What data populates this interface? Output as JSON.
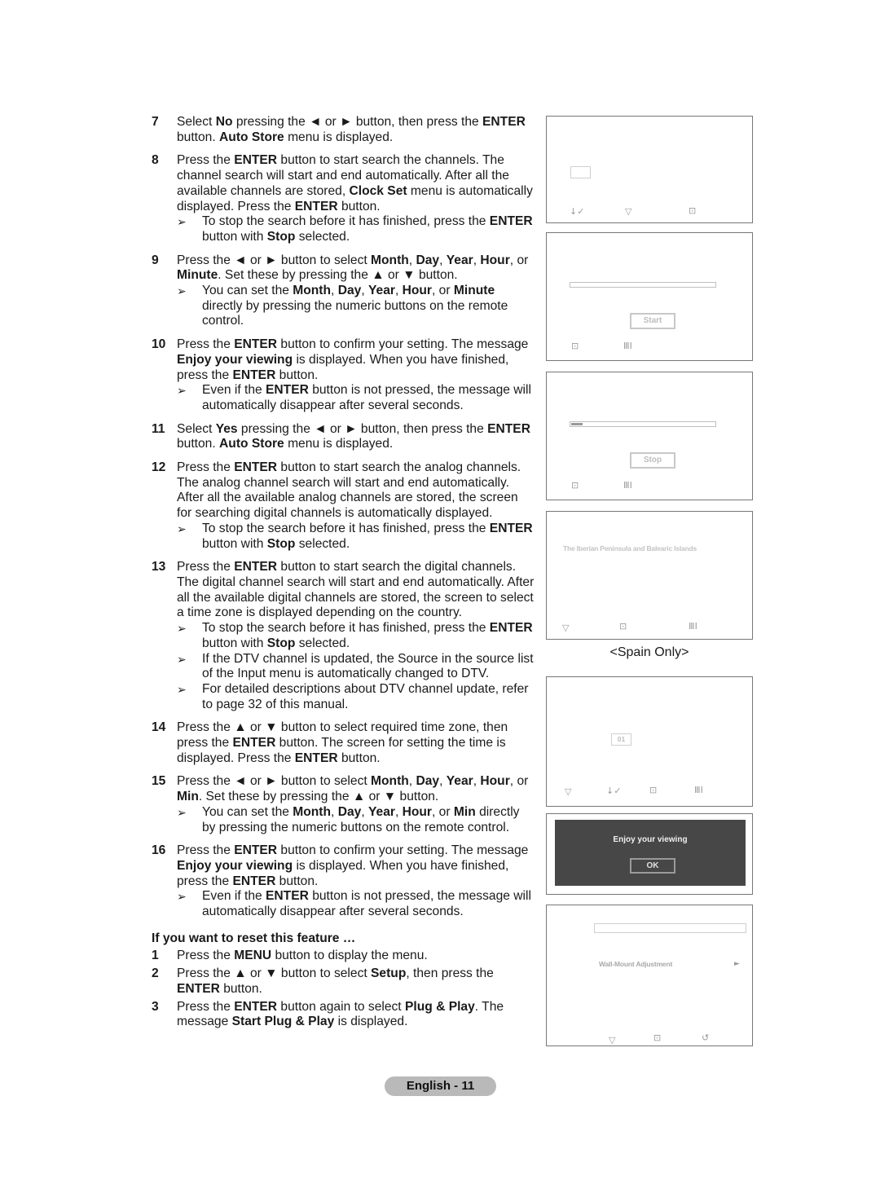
{
  "steps": [
    {
      "num": "7",
      "text": [
        {
          "t": "Select "
        },
        {
          "b": "No"
        },
        {
          "t": " pressing the ◄ or ► button, then press the "
        },
        {
          "b": "ENTER"
        },
        {
          "t": " button. "
        },
        {
          "b": "Auto Store"
        },
        {
          "t": " menu is displayed."
        }
      ],
      "notes": []
    },
    {
      "num": "8",
      "text": [
        {
          "t": "Press the "
        },
        {
          "b": "ENTER"
        },
        {
          "t": " button to start search the channels. The channel search will start and end automatically. After all the available channels are stored, "
        },
        {
          "b": "Clock Set"
        },
        {
          "t": " menu is automatically displayed. Press the "
        },
        {
          "b": "ENTER"
        },
        {
          "t": " button."
        }
      ],
      "notes": [
        [
          {
            "t": "To stop the search before it has finished, press the "
          },
          {
            "b": "ENTER"
          },
          {
            "t": " button with "
          },
          {
            "b": "Stop"
          },
          {
            "t": " selected."
          }
        ]
      ]
    },
    {
      "num": "9",
      "text": [
        {
          "t": "Press the ◄ or ► button to select "
        },
        {
          "b": "Month"
        },
        {
          "t": ", "
        },
        {
          "b": "Day"
        },
        {
          "t": ", "
        },
        {
          "b": "Year"
        },
        {
          "t": ", "
        },
        {
          "b": "Hour"
        },
        {
          "t": ", or "
        },
        {
          "b": "Minute"
        },
        {
          "t": ". Set these by pressing the ▲ or ▼ button."
        }
      ],
      "notes": [
        [
          {
            "t": "You can set the "
          },
          {
            "b": "Month"
          },
          {
            "t": ", "
          },
          {
            "b": "Day"
          },
          {
            "t": ", "
          },
          {
            "b": "Year"
          },
          {
            "t": ", "
          },
          {
            "b": "Hour"
          },
          {
            "t": ", or "
          },
          {
            "b": "Minute"
          },
          {
            "t": " directly by pressing the numeric buttons on the remote control."
          }
        ]
      ]
    },
    {
      "num": "10",
      "text": [
        {
          "t": "Press the "
        },
        {
          "b": "ENTER"
        },
        {
          "t": " button to confirm your setting. The message "
        },
        {
          "b": "Enjoy your viewing"
        },
        {
          "t": " is displayed. When you have finished, press the "
        },
        {
          "b": "ENTER"
        },
        {
          "t": " button."
        }
      ],
      "notes": [
        [
          {
            "t": "Even if the "
          },
          {
            "b": "ENTER"
          },
          {
            "t": " button is not pressed, the message will automatically disappear after several seconds."
          }
        ]
      ]
    },
    {
      "num": "11",
      "text": [
        {
          "t": "Select "
        },
        {
          "b": "Yes"
        },
        {
          "t": " pressing the ◄ or ► button, then press the "
        },
        {
          "b": "ENTER"
        },
        {
          "t": " button. "
        },
        {
          "b": "Auto Store"
        },
        {
          "t": " menu is displayed."
        }
      ],
      "notes": []
    },
    {
      "num": "12",
      "text": [
        {
          "t": "Press the "
        },
        {
          "b": "ENTER"
        },
        {
          "t": " button to start search the analog channels. The analog channel search will start and end automatically. After all the available analog channels are stored, the screen for searching digital channels is automatically displayed."
        }
      ],
      "notes": [
        [
          {
            "t": "To stop the search before it has finished, press the "
          },
          {
            "b": "ENTER"
          },
          {
            "t": " button with "
          },
          {
            "b": "Stop"
          },
          {
            "t": " selected."
          }
        ]
      ]
    },
    {
      "num": "13",
      "text": [
        {
          "t": "Press the "
        },
        {
          "b": "ENTER"
        },
        {
          "t": " button to start search the digital channels. The digital channel search will start and end automatically. After all the available digital channels are stored, the screen to select a time zone is displayed depending on the country."
        }
      ],
      "notes": [
        [
          {
            "t": "To stop the search before it has finished, press the "
          },
          {
            "b": "ENTER"
          },
          {
            "t": " button with "
          },
          {
            "b": "Stop"
          },
          {
            "t": " selected."
          }
        ],
        [
          {
            "t": "If the DTV channel is updated, the Source in the source list of the Input menu is automatically changed to DTV."
          }
        ],
        [
          {
            "t": "For detailed descriptions about DTV channel update, refer to page 32 of this manual."
          }
        ]
      ]
    },
    {
      "num": "14",
      "text": [
        {
          "t": "Press the ▲ or ▼ button to select required time zone, then press the "
        },
        {
          "b": "ENTER"
        },
        {
          "t": " button. The screen for setting the time is displayed. Press the "
        },
        {
          "b": "ENTER"
        },
        {
          "t": " button."
        }
      ],
      "notes": []
    },
    {
      "num": "15",
      "text": [
        {
          "t": "Press the ◄ or ► button to select "
        },
        {
          "b": "Month"
        },
        {
          "t": ", "
        },
        {
          "b": "Day"
        },
        {
          "t": ", "
        },
        {
          "b": "Year"
        },
        {
          "t": ", "
        },
        {
          "b": "Hour"
        },
        {
          "t": ", or "
        },
        {
          "b": "Min"
        },
        {
          "t": ". Set these by pressing the ▲ or ▼ button."
        }
      ],
      "notes": [
        [
          {
            "t": "You can set the "
          },
          {
            "b": "Month"
          },
          {
            "t": ", "
          },
          {
            "b": "Day"
          },
          {
            "t": ", "
          },
          {
            "b": "Year"
          },
          {
            "t": ", "
          },
          {
            "b": "Hour"
          },
          {
            "t": ", or "
          },
          {
            "b": "Min"
          },
          {
            "t": " directly by pressing the numeric buttons on the remote control."
          }
        ]
      ]
    },
    {
      "num": "16",
      "text": [
        {
          "t": "Press the "
        },
        {
          "b": "ENTER"
        },
        {
          "t": " button to confirm your setting. The message "
        },
        {
          "b": "Enjoy your viewing"
        },
        {
          "t": " is displayed. When you have finished, press the "
        },
        {
          "b": "ENTER"
        },
        {
          "t": " button."
        }
      ],
      "notes": [
        [
          {
            "t": "Even if the "
          },
          {
            "b": "ENTER"
          },
          {
            "t": " button is not pressed, the message will automatically disappear after several seconds."
          }
        ]
      ]
    }
  ],
  "reset": {
    "title": "If you want to reset this feature …",
    "steps": [
      {
        "num": "1",
        "text": [
          {
            "t": "Press the "
          },
          {
            "b": "MENU"
          },
          {
            "t": " button to display the menu."
          }
        ]
      },
      {
        "num": "2",
        "text": [
          {
            "t": "Press the ▲ or ▼ button to select "
          },
          {
            "b": "Setup"
          },
          {
            "t": ", then press the "
          },
          {
            "b": "ENTER"
          },
          {
            "t": " button."
          }
        ]
      },
      {
        "num": "3",
        "text": [
          {
            "t": "Press the "
          },
          {
            "b": "ENTER"
          },
          {
            "t": " button again to select "
          },
          {
            "b": "Plug & Play"
          },
          {
            "t": ". The message "
          },
          {
            "b": "Start Plug & Play"
          },
          {
            "t": " is displayed."
          }
        ]
      }
    ]
  },
  "note_arrow": "➢",
  "screens": {
    "auto_store_prompt": {
      "icons": [
        "move-icon",
        "adjust-icon",
        "enter-icon"
      ]
    },
    "analog_search": {
      "button": "Start",
      "progress": 0,
      "icons": [
        "enter-icon",
        "return-icon"
      ]
    },
    "analog_searching": {
      "button": "Stop",
      "progress": 0.08,
      "icons": [
        "enter-icon",
        "return-icon"
      ]
    },
    "time_zone": {
      "item": "The Iberian Peninsula and Balearic Islands",
      "caption": "<Spain Only>",
      "icons": [
        "adjust-icon",
        "enter-icon",
        "return-icon"
      ]
    },
    "clock_set": {
      "value": "01",
      "icons": [
        "adjust-icon",
        "move-icon",
        "enter-icon",
        "return-icon"
      ]
    },
    "enjoy": {
      "message": "Enjoy your viewing",
      "ok": "OK"
    },
    "setup_menu": {
      "item": "Wall-Mount Adjustment",
      "item_arrow": "►",
      "icons": [
        "adjust-icon",
        "enter-icon",
        "return-icon"
      ]
    }
  },
  "icon_glyphs": {
    "move-icon": "↓✓",
    "adjust-icon": "▽",
    "enter-icon": "⊡",
    "return-icon": "ⅢⅠ",
    "reset-icon": "↺"
  },
  "footer": {
    "label": "English - 11"
  }
}
